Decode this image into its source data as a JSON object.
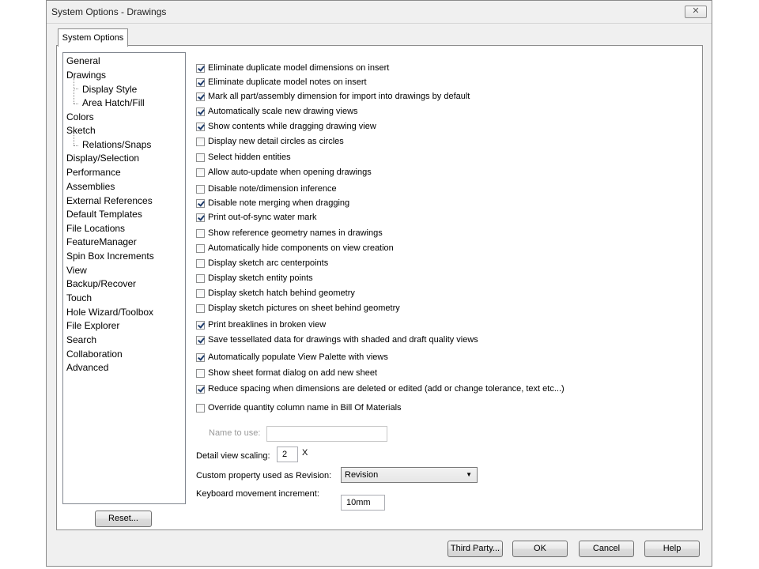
{
  "window": {
    "title": "System Options - Drawings",
    "close_glyph": "✕"
  },
  "tabs": [
    {
      "label": "System Options"
    }
  ],
  "tree": [
    {
      "label": "General",
      "level": 0
    },
    {
      "label": "Drawings",
      "level": 0
    },
    {
      "label": "Display Style",
      "level": 1
    },
    {
      "label": "Area Hatch/Fill",
      "level": 1
    },
    {
      "label": "Colors",
      "level": 0
    },
    {
      "label": "Sketch",
      "level": 0
    },
    {
      "label": "Relations/Snaps",
      "level": 1
    },
    {
      "label": "Display/Selection",
      "level": 0
    },
    {
      "label": "Performance",
      "level": 0
    },
    {
      "label": "Assemblies",
      "level": 0
    },
    {
      "label": "External References",
      "level": 0
    },
    {
      "label": "Default Templates",
      "level": 0
    },
    {
      "label": "File Locations",
      "level": 0
    },
    {
      "label": "FeatureManager",
      "level": 0
    },
    {
      "label": "Spin Box Increments",
      "level": 0
    },
    {
      "label": "View",
      "level": 0
    },
    {
      "label": "Backup/Recover",
      "level": 0
    },
    {
      "label": "Touch",
      "level": 0
    },
    {
      "label": "Hole Wizard/Toolbox",
      "level": 0
    },
    {
      "label": "File Explorer",
      "level": 0
    },
    {
      "label": "Search",
      "level": 0
    },
    {
      "label": "Collaboration",
      "level": 0
    },
    {
      "label": "Advanced",
      "level": 0
    }
  ],
  "options": [
    {
      "label": "Eliminate duplicate model dimensions on insert",
      "checked": true
    },
    {
      "label": "Eliminate duplicate model notes on insert",
      "checked": true
    },
    {
      "label": "Mark all part/assembly dimension for import into drawings by default",
      "checked": true
    },
    {
      "label": "Automatically scale new drawing views",
      "checked": true
    },
    {
      "label": "Show contents while dragging drawing view",
      "checked": true
    },
    {
      "label": "Display new detail circles as circles",
      "checked": false
    },
    {
      "label": "Select hidden entities",
      "checked": false
    },
    {
      "label": "Allow auto-update when opening drawings",
      "checked": false
    },
    {
      "label": "Disable note/dimension inference",
      "checked": false
    },
    {
      "label": "Disable note merging when dragging",
      "checked": true
    },
    {
      "label": "Print out-of-sync water mark",
      "checked": true
    },
    {
      "label": "Show reference geometry names in drawings",
      "checked": false
    },
    {
      "label": "Automatically hide components on view creation",
      "checked": false
    },
    {
      "label": "Display sketch arc centerpoints",
      "checked": false
    },
    {
      "label": "Display sketch entity points",
      "checked": false
    },
    {
      "label": "Display sketch hatch behind geometry",
      "checked": false
    },
    {
      "label": "Display sketch pictures on sheet behind geometry",
      "checked": false
    },
    {
      "label": "Print breaklines in broken view",
      "checked": true
    },
    {
      "label": "Save tessellated data for drawings with shaded and draft quality views",
      "checked": true
    },
    {
      "label": "Automatically populate View Palette with views",
      "checked": true
    },
    {
      "label": "Show sheet format dialog on add new sheet",
      "checked": false
    },
    {
      "label": "Reduce spacing when dimensions are deleted or edited (add or change tolerance, text etc...)",
      "checked": true
    },
    {
      "label": "Override quantity column name in Bill Of Materials",
      "checked": false
    }
  ],
  "fields": {
    "name_to_use": {
      "label": "Name to use:",
      "value": ""
    },
    "detail_scaling": {
      "label": "Detail view scaling:",
      "value": "2",
      "suffix": "X"
    },
    "revision": {
      "label": "Custom property used as Revision:",
      "value": "Revision"
    },
    "keyboard_increment": {
      "label": "Keyboard movement increment:",
      "value": "10mm"
    }
  },
  "buttons": {
    "reset": "Reset...",
    "third_party": "Third Party...",
    "ok": "OK",
    "cancel": "Cancel",
    "help": "Help"
  }
}
